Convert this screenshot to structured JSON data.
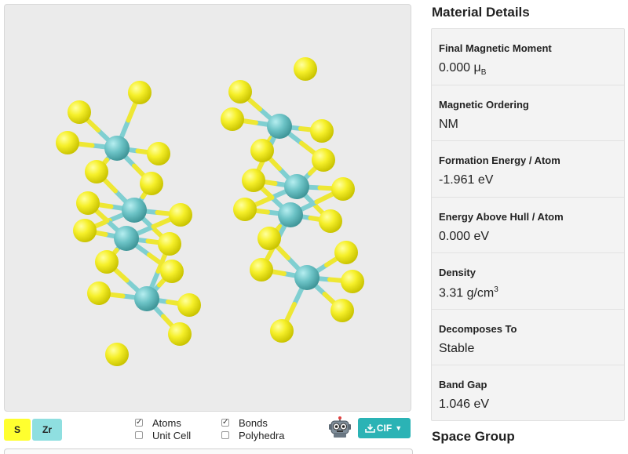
{
  "viewer": {
    "legend": [
      {
        "label": "S",
        "color": "#ffff2f"
      },
      {
        "label": "Zr",
        "color": "#8fdfe0"
      }
    ],
    "options": [
      {
        "label": "Atoms",
        "checked": true
      },
      {
        "label": "Unit Cell",
        "checked": false
      },
      {
        "label": "Bonds",
        "checked": true
      },
      {
        "label": "Polyhedra",
        "checked": false
      }
    ],
    "download_label": "CIF",
    "icons": {
      "robot": "robot-icon",
      "download": "download-icon",
      "caret": "caret-down-icon"
    },
    "colors": {
      "s_atom": "#f4ee2c",
      "zr_atom": "#6cc3c6",
      "button": "#2bb3b5"
    }
  },
  "details": {
    "title": "Material Details",
    "rows": [
      {
        "label": "Final Magnetic Moment",
        "value": "0.000 μ",
        "sub": "B",
        "sup": ""
      },
      {
        "label": "Magnetic Ordering",
        "value": "NM",
        "sub": "",
        "sup": ""
      },
      {
        "label": "Formation Energy / Atom",
        "value": "-1.961 eV",
        "sub": "",
        "sup": ""
      },
      {
        "label": "Energy Above Hull / Atom",
        "value": "0.000 eV",
        "sub": "",
        "sup": ""
      },
      {
        "label": "Density",
        "value": "3.31 g/cm",
        "sub": "",
        "sup": "3"
      },
      {
        "label": "Decomposes To",
        "value": "Stable",
        "sub": "",
        "sup": ""
      },
      {
        "label": "Band Gap",
        "value": "1.046 eV",
        "sub": "",
        "sup": ""
      }
    ]
  },
  "space_group": {
    "title": "Space Group"
  }
}
